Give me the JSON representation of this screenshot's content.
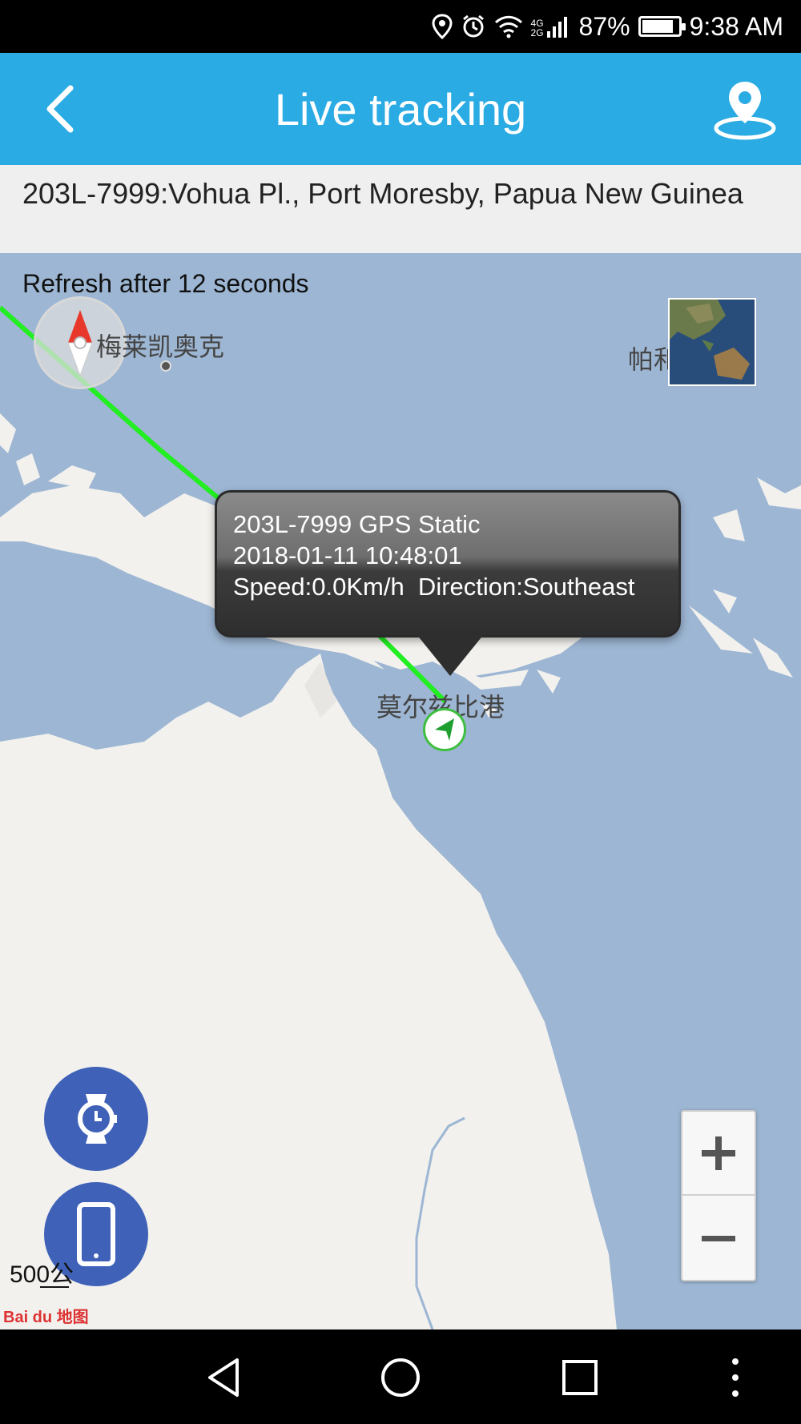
{
  "status_bar": {
    "signal_label": "4G 2G",
    "battery": "87%",
    "battery_level": 0.87,
    "time": "9:38 AM",
    "icons": [
      "location-icon",
      "alarm-icon",
      "wifi-icon",
      "cell-signal-icon",
      "battery-icon"
    ]
  },
  "header": {
    "title": "Live tracking",
    "back_icon": "chevron-left-icon",
    "location_icon": "map-pin-icon"
  },
  "address": {
    "text": "203L-7999:Vohua Pl., Port Moresby, Papua New Guinea"
  },
  "map": {
    "refresh_text": "Refresh after 12 seconds",
    "place_labels": {
      "merauke": "梅莱凯奥克",
      "palau": "帕和",
      "port_moresby": "莫尔兹比港"
    },
    "popup": {
      "line1": "203L-7999 GPS Static",
      "line2": "2018-01-11 10:48:01",
      "line3": "Speed:0.0Km/h  Direction:Southeast"
    },
    "track_color": "#22ee22",
    "scale_text": "500公",
    "provider_logo": "Bai du 地图",
    "zoom_in_icon": "plus-icon",
    "zoom_out_icon": "minus-icon",
    "compass_icon": "compass-icon",
    "satellite_toggle_icon": "satellite-thumbnail"
  },
  "fabs": {
    "watch_icon": "smartwatch-icon",
    "phone_icon": "smartphone-icon"
  },
  "colors": {
    "primary": "#2aabe3",
    "fab": "#3f62b8",
    "sea": "#9db6d3",
    "land": "#f2f1ee"
  },
  "nav": {
    "back": "triangle-back-icon",
    "home": "circle-home-icon",
    "recents": "square-recents-icon",
    "more": "vertical-dots-icon"
  }
}
